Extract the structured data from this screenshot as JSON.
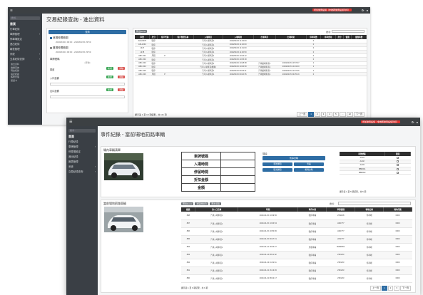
{
  "win1": {
    "badge": "增加優惠設施（非推薦優惠設施列印）",
    "icons": "⚙ · ●",
    "sidebar": {
      "search": "搜尋...",
      "section1": "首頁",
      "items": [
        {
          "label": "行車紀錄"
        },
        {
          "label": "車牌管理",
          "arrow": "‹"
        },
        {
          "label": "停車場設定"
        },
        {
          "label": "進出紀錄"
        },
        {
          "label": "報表管理"
        },
        {
          "label": "系統",
          "arrow": "‹"
        },
        {
          "label": "交易紀錄查詢",
          "arrow": "‹"
        }
      ],
      "subs": [
        "進出資料",
        "繳費查詢",
        "現金紀錄",
        "設定紀錄",
        "帳務管理",
        "悠遊卡"
      ]
    },
    "title": "交易紀錄查詢 - 進出資料",
    "filter": {
      "header": "查詢",
      "enter_label": "進場時間範圍",
      "enter_range": "2020/04/01 00:00 - 2020/04/15 23:59",
      "leave_label": "離場時間範圍",
      "leave_range": "2020/04/01 00:00 - 2020/04/15 23:59",
      "plate_label": "車牌號碼",
      "plate_value": "(車號)",
      "entry_label": "入口設備",
      "exit_label": "出口設備",
      "lane_label": "車道",
      "add": "新增",
      "clear": "清除"
    },
    "table": {
      "export": "匯出Excel",
      "search_label": "搜尋:",
      "headers": [
        "車號",
        "身分",
        "客戶代碼",
        "客戶類型名稱",
        "入場車道",
        "入場時間",
        "出場車道",
        "出場時間",
        "停車時數",
        "停車費用",
        "身分",
        "優惠",
        "優惠時數"
      ],
      "rows": [
        [
          "AGU0079",
          "臨停",
          "",
          "",
          "汽車入場車道1",
          "2020/04/15 11:04:00",
          "",
          "",
          "0",
          "",
          "",
          "",
          ""
        ],
        [
          "ASL1234",
          "臨停",
          "",
          "",
          "汽車入場車道1",
          "2020/04/15 11:02:00",
          "",
          "",
          "0",
          "",
          "",
          "",
          ""
        ],
        [
          "1447",
          "臨停",
          "",
          "",
          "汽車入場車道1",
          "2020/04/15 11:01:00",
          "",
          "",
          "0",
          "",
          "",
          "",
          ""
        ],
        [
          "1478",
          "臨停",
          "",
          "",
          "汽車入場車道1",
          "2020/04/15 11:00:50",
          "",
          "",
          "0",
          "",
          "",
          "",
          ""
        ],
        [
          "ABC-001",
          "月租",
          "P",
          "",
          "汽車入場車道1",
          "2020/04/15 10:46:12",
          "",
          "",
          "0",
          "",
          "",
          "",
          ""
        ],
        [
          "ABC-002",
          "臨停",
          "",
          "",
          "汽車入場車道1",
          "2020/04/15 10:35:18",
          "",
          "",
          "0",
          "",
          "",
          "",
          ""
        ],
        [
          "ABC-003",
          "臨停",
          "",
          "",
          "汽車入場車道1",
          "2020/04/15 10:28:38",
          "汽車離場車道1",
          "2020/04/15 10:57:07",
          "1",
          "",
          "",
          "",
          ""
        ],
        [
          "ABC-004",
          "臨停",
          "",
          "",
          "汽車入場車道(機車)",
          "2020/04/15 10:06:50",
          "汽車離場車道1",
          "2020/04/15 10:24:00",
          "1",
          "",
          "",
          "",
          ""
        ],
        [
          "ABC-005",
          "臨停",
          "",
          "",
          "汽車入場車道1",
          "2020/04/15 09:45:21",
          "汽車離場車道1",
          "2020/04/15 10:07:06",
          "1",
          "",
          "",
          "",
          ""
        ],
        [
          "ABC-006",
          "月租",
          "P",
          "",
          "汽車入場車道1",
          "2020/04/15 09:20:35",
          "汽車離場車道1",
          "2020/04/15 09:25:19",
          "0",
          "",
          "",
          "",
          ""
        ]
      ],
      "footer": "顯示第 1 至 10 項結果，共 111 項",
      "pager": [
        "上一頁",
        "1",
        "2",
        "3",
        "4",
        "5",
        "…",
        "12",
        "下一頁"
      ]
    }
  },
  "win2": {
    "badge": "增加優惠設施（非推薦優惠設施列印）",
    "icons": "⚙ · ●",
    "sidebar": {
      "search": "搜尋...",
      "section1": "首頁",
      "items": [
        {
          "label": "行車紀錄"
        },
        {
          "label": "車牌管理",
          "arrow": "‹"
        },
        {
          "label": "停車場設定"
        },
        {
          "label": "進出紀錄"
        },
        {
          "label": "報表管理"
        },
        {
          "label": "系統",
          "arrow": "‹"
        },
        {
          "label": "交易紀錄查詢",
          "arrow": "‹"
        }
      ]
    },
    "title": "事件紀錄 - 當前場地罰路車輛",
    "car_label": "場內車輛清單",
    "info_rows": [
      "車牌號碼",
      "入場時間",
      "停留時間",
      "折扣金額",
      "金額"
    ],
    "side_search": "搜尋:",
    "blue_main": "暫停計時",
    "blue_grid": [
      "發送通知",
      "查看",
      "取消通知",
      "暫時計時"
    ],
    "small_table": {
      "headers": [
        "車號號碼",
        "選擇"
      ],
      "rows": [
        [
          "AA01",
          ""
        ],
        [
          "AA02",
          ""
        ],
        [
          "AA03",
          ""
        ],
        [
          "BBB001",
          ""
        ],
        [
          "BBB002",
          ""
        ]
      ],
      "footer": "顯示第 1 至 5 項結果，共 5 項"
    },
    "lower_label": "當前場地罰路車輛",
    "lower_buttons": [
      "匯出Excel",
      "選取欄位列",
      "匯出報表"
    ],
    "lower_search": "搜尋:",
    "big_table": {
      "headers": [
        "編號",
        "進入口名稱",
        "時間",
        "事件內容",
        "車牌號碼",
        "場地名稱",
        "場地代碼"
      ],
      "rows": [
        [
          "898",
          "汽車入場車道1",
          "2020-04-15 13:09:56",
          "臨停車輛",
          "ZFS168",
          "停車場",
          "0000"
        ],
        [
          "897",
          "汽車入場車道1",
          "2020-04-15 13:04:54",
          "臨停車輛",
          "ASD777",
          "停車場",
          "0000"
        ],
        [
          "896",
          "汽車入場車道1",
          "2020-04-15 10:50:06",
          "臨停車輛",
          "ASD777",
          "停車場",
          "0000"
        ],
        [
          "895",
          "汽車入場車道1",
          "2020-04-15 09:47:31",
          "臨停車輛",
          "ZAS777",
          "停車場",
          "0000"
        ],
        [
          "894",
          "汽車入場車道1",
          "2020-04-14 18:34:37",
          "月租車輛",
          "BAB0951",
          "停車場",
          "0000"
        ],
        [
          "893",
          "汽車入場車道1",
          "2020-04-14 08:11:02",
          "臨停車輛",
          "ZSF263",
          "停車場",
          "0000"
        ],
        [
          "892",
          "汽車入場車道1",
          "2020-04-13 21:02:11",
          "臨停車輛",
          "ZSF263",
          "停車場",
          "0000"
        ],
        [
          "891",
          "汽車入場車道1",
          "2020-04-13 16:13:26",
          "臨停車輛",
          "ZSF263",
          "停車場",
          "0000"
        ],
        [
          "890",
          "汽車入場車道1",
          "2020-04-13 08:22:17",
          "臨停車輛",
          "ZSF263",
          "停車場",
          "0000"
        ]
      ],
      "footer": "顯示第 1 至 9 項結果，共 9 項",
      "pager": [
        "上一頁",
        "1",
        "2",
        "3",
        "下一頁"
      ]
    }
  }
}
